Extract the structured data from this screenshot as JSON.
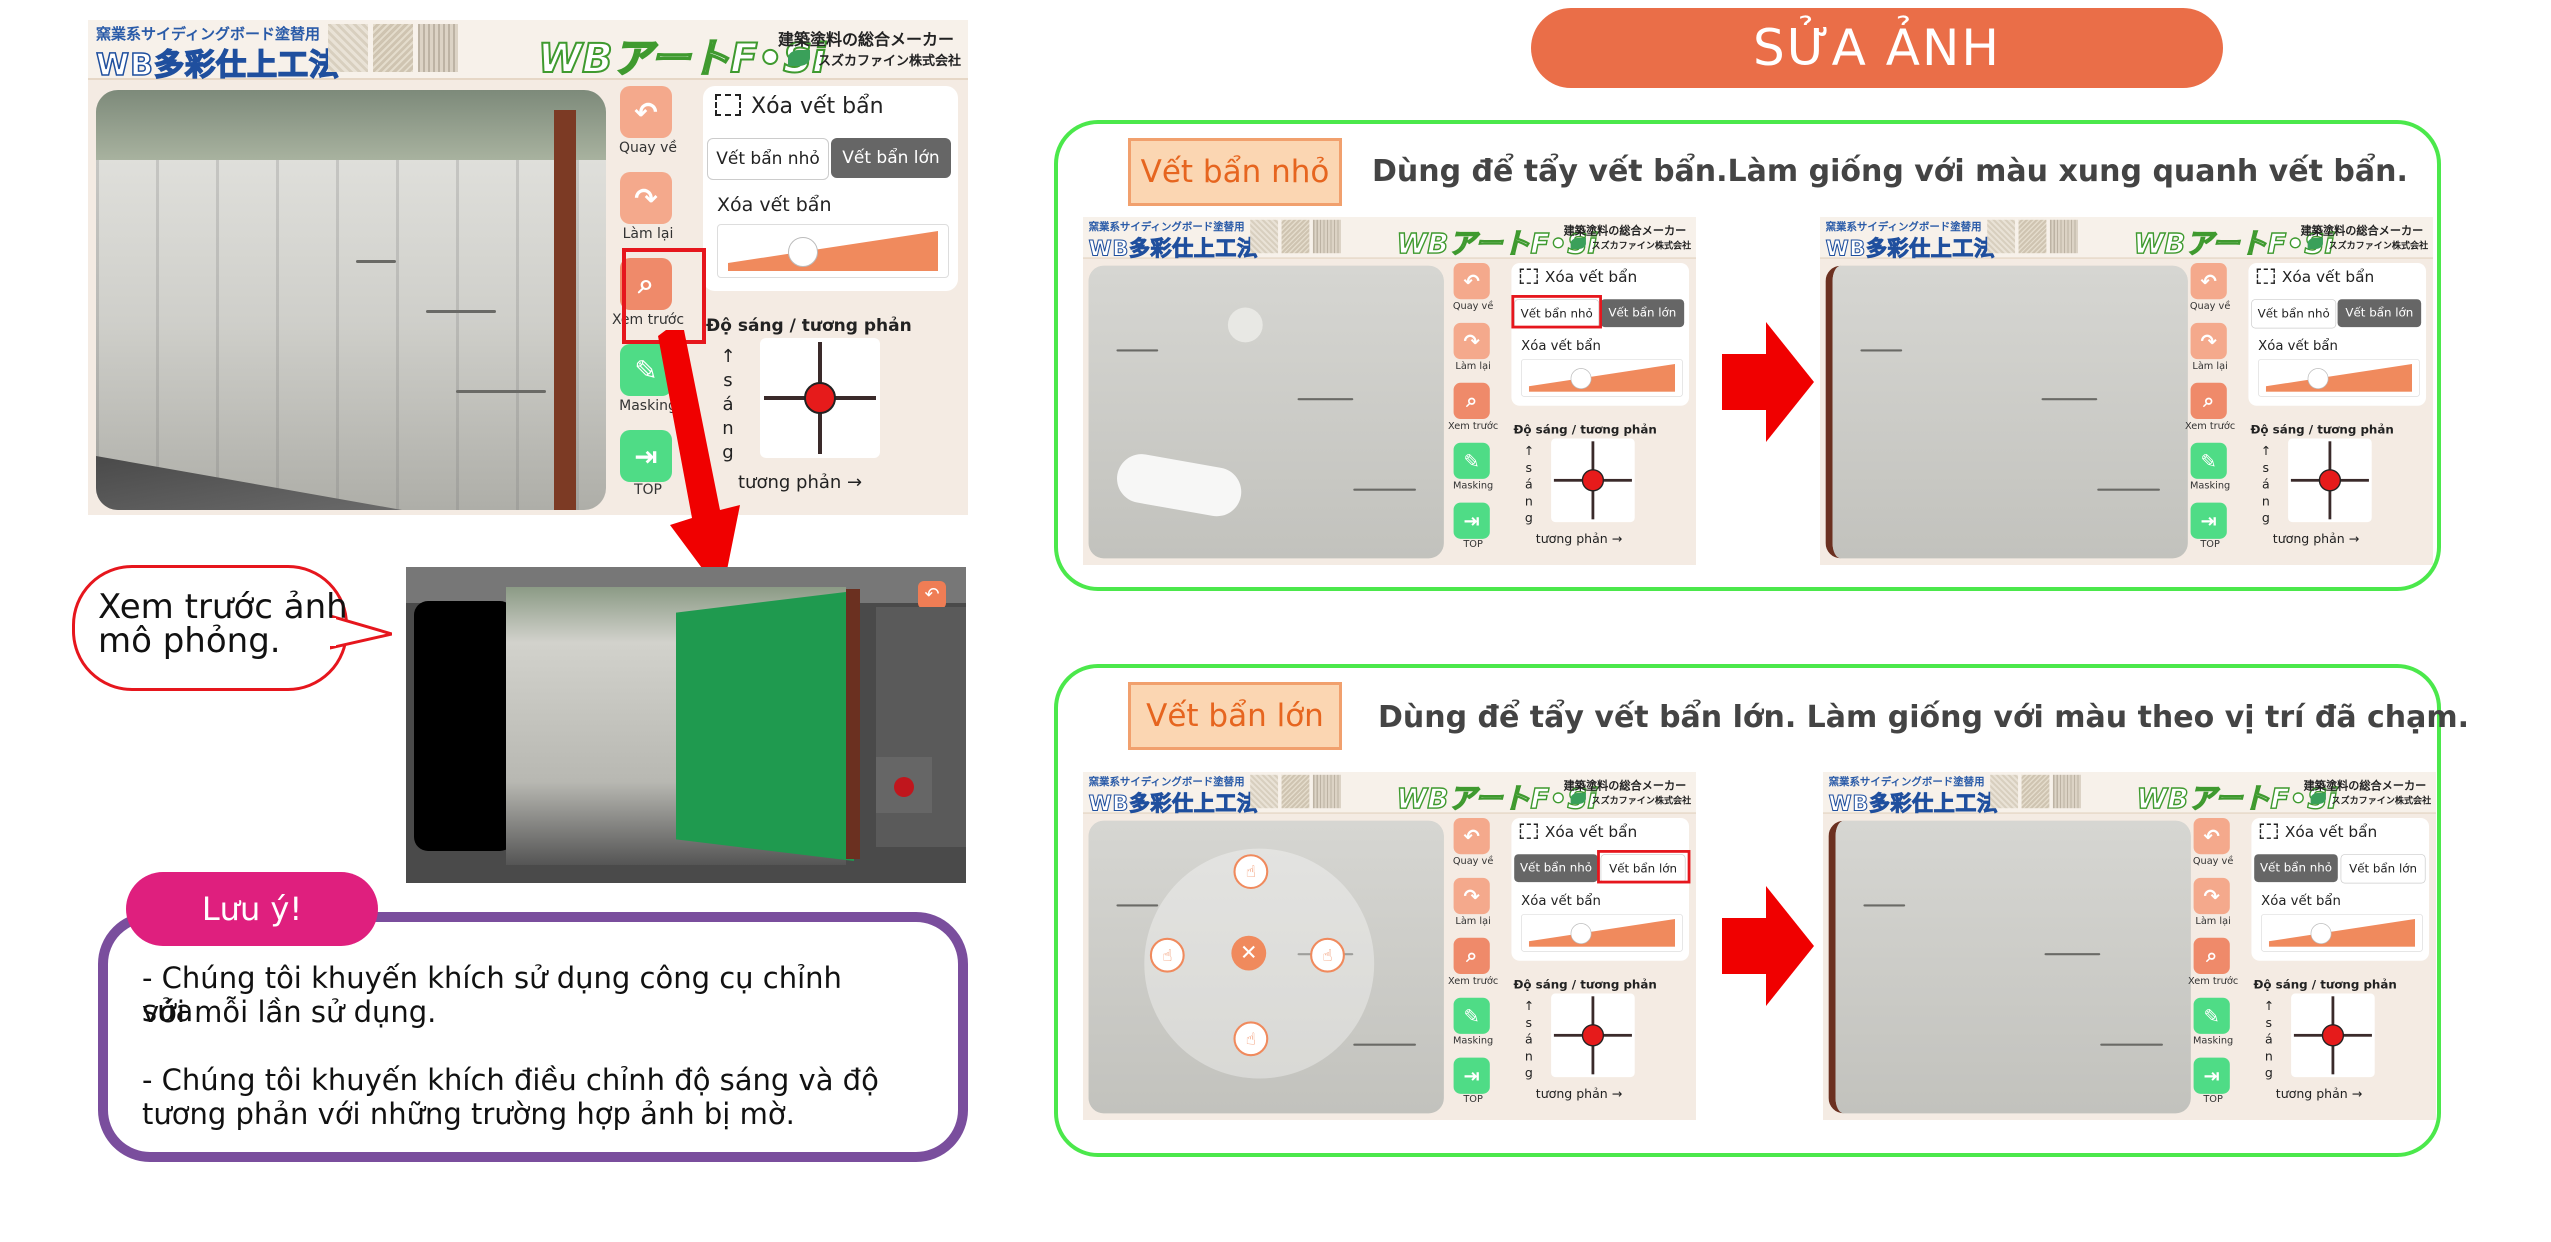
{
  "page_title": "SỬA ẢNH",
  "app": {
    "banner_top": "窯業系サイディングボード塗替用",
    "banner_logo": "WB多彩仕上工法",
    "art_logo": "WBアートF•Si",
    "maker": "建築塗料の総合メーカー",
    "company": "スズカファイン株式会社",
    "undo_label": "Quay về",
    "redo_label": "Làm lại",
    "preview_label": "Xem trước",
    "masking_label": "Masking",
    "top_label": "TOP",
    "panel_title": "Xóa vết bẩn",
    "seg_small": "Vết bẩn nhỏ",
    "seg_large": "Vết bẩn lớn",
    "slider_label": "Xóa vết bẩn",
    "brightness_label": "Độ sáng / tương phản",
    "vertical_label": "↑ s á n g",
    "horizontal_label": "tương phản →"
  },
  "callout": {
    "line1": "Xem trước ảnh",
    "line2": "mô phỏng."
  },
  "note": {
    "title": "Lưu ý!",
    "p1_l1": "- Chúng tôi khuyến khích sử dụng công cụ chỉnh sửa",
    "p1_l2": "với mỗi lần sử dụng.",
    "p2_l1": "- Chúng tôi khuyến khích điều chỉnh độ sáng và độ",
    "p2_l2": "tương phản với những trường hợp ảnh bị mờ."
  },
  "section_small": {
    "tag": "Vết bẩn nhỏ",
    "description": "Dùng để tẩy vết bẩn.Làm giống với màu xung quanh vết bẩn."
  },
  "section_large": {
    "tag": "Vết bẩn lớn",
    "description": "Dùng để tẩy vết bẩn lớn. Làm giống với màu theo vị trí đã chạm."
  },
  "colors": {
    "title_pill": "#ea6e48",
    "green_frame": "#4be84b",
    "red": "#e6161d",
    "note_border": "#7a4e9d",
    "note_pill": "#df1f7e",
    "accent_orange": "#f08a5d",
    "masking_green": "#4fdc86"
  },
  "icons": [
    "undo-icon",
    "redo-icon",
    "preview-icon",
    "masking-icon",
    "top-exit-icon",
    "selection-icon",
    "hand-tap-icon",
    "close-icon",
    "arrow-icon"
  ]
}
